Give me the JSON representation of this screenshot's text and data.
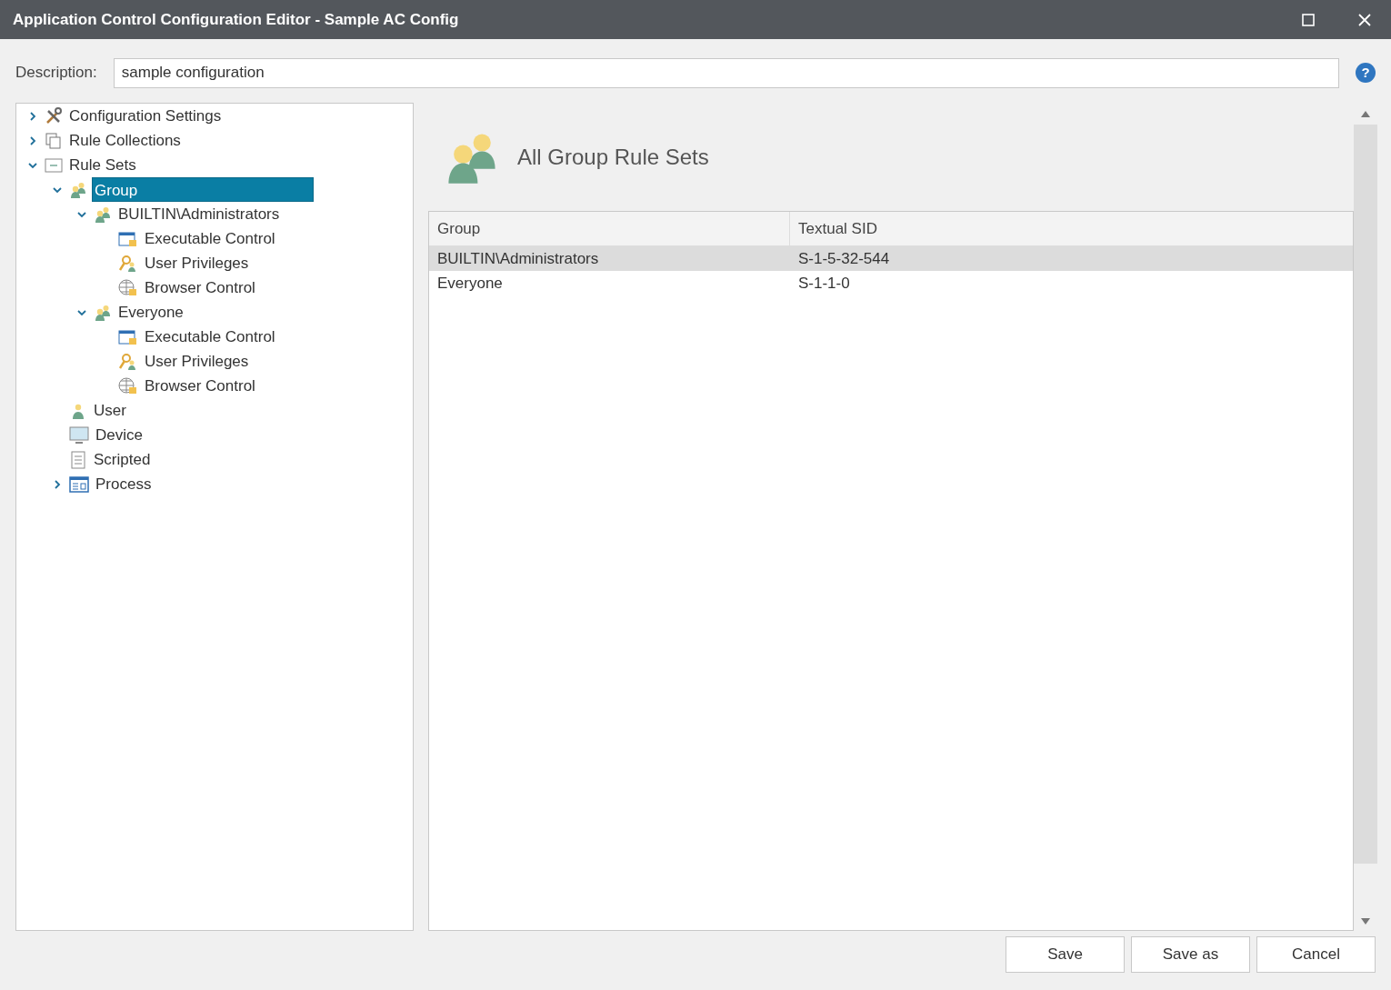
{
  "window": {
    "title": "Application Control Configuration Editor - Sample AC Config"
  },
  "description": {
    "label": "Description:",
    "value": "sample configuration",
    "help": "?"
  },
  "tree": [
    {
      "label": "Configuration Settings",
      "kind": "tools",
      "expanded": false,
      "selected": false
    },
    {
      "label": "Rule Collections",
      "kind": "collection",
      "expanded": false,
      "selected": false
    },
    {
      "label": "Rule Sets",
      "kind": "ruleset",
      "expanded": true,
      "selected": false,
      "children": [
        {
          "label": "Group",
          "kind": "group",
          "expanded": true,
          "selected": true,
          "children": [
            {
              "label": "BUILTIN\\Administrators",
              "kind": "group",
              "expanded": true,
              "selected": false,
              "children": [
                {
                  "label": "Executable Control",
                  "kind": "exe",
                  "selected": false
                },
                {
                  "label": "User Privileges",
                  "kind": "privilege",
                  "selected": false
                },
                {
                  "label": "Browser Control",
                  "kind": "browser",
                  "selected": false
                }
              ]
            },
            {
              "label": "Everyone",
              "kind": "group",
              "expanded": true,
              "selected": false,
              "children": [
                {
                  "label": "Executable Control",
                  "kind": "exe",
                  "selected": false
                },
                {
                  "label": "User Privileges",
                  "kind": "privilege",
                  "selected": false
                },
                {
                  "label": "Browser Control",
                  "kind": "browser",
                  "selected": false
                }
              ]
            }
          ]
        },
        {
          "label": "User",
          "kind": "user",
          "selected": false
        },
        {
          "label": "Device",
          "kind": "device",
          "selected": false
        },
        {
          "label": "Scripted",
          "kind": "script",
          "selected": false
        },
        {
          "label": "Process",
          "kind": "process",
          "expanded": false,
          "selected": false
        }
      ]
    }
  ],
  "panel": {
    "title": "All Group Rule Sets"
  },
  "table": {
    "columns": [
      "Group",
      "Textual SID"
    ],
    "rows": [
      {
        "cells": [
          "BUILTIN\\Administrators",
          "S-1-5-32-544"
        ],
        "selected": true
      },
      {
        "cells": [
          "Everyone",
          "S-1-1-0"
        ],
        "selected": false
      }
    ]
  },
  "buttons": [
    "Save",
    "Save as",
    "Cancel"
  ]
}
